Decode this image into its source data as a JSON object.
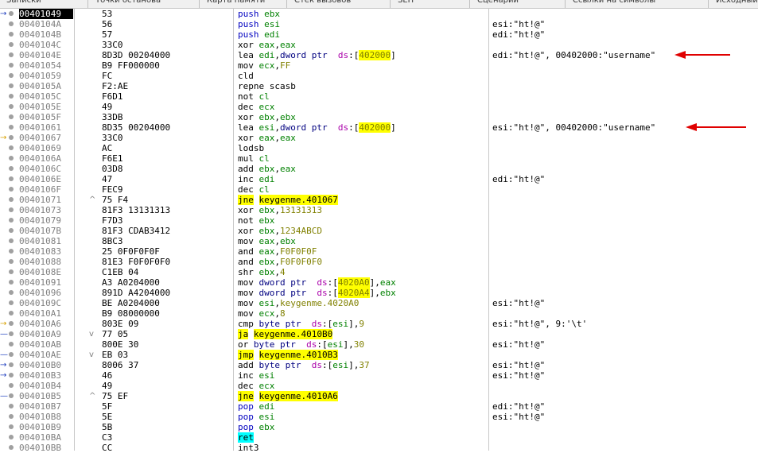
{
  "toolbar": {
    "tabs": [
      "Записки",
      "Точки останова",
      "Карта памяти",
      "Стек вызовов",
      "SEH",
      "Сценарий",
      "Ссылки на символы",
      "Исходный текст"
    ]
  },
  "rows": [
    {
      "addr": "00401049",
      "bytes": "53",
      "parts": [
        [
          "push",
          "m-b"
        ],
        [
          " ",
          ""
        ],
        [
          "ebx",
          "reg"
        ]
      ],
      "cmt": "",
      "cur": true,
      "arrow": "→"
    },
    {
      "addr": "0040104A",
      "bytes": "56",
      "parts": [
        [
          "push",
          "m-b"
        ],
        [
          " ",
          ""
        ],
        [
          "esi",
          "reg"
        ]
      ],
      "cmt": "esi:\"ht!@\""
    },
    {
      "addr": "0040104B",
      "bytes": "57",
      "parts": [
        [
          "push",
          "m-b"
        ],
        [
          " ",
          ""
        ],
        [
          "edi",
          "reg"
        ]
      ],
      "cmt": "edi:\"ht!@\""
    },
    {
      "addr": "0040104C",
      "bytes": "33C0",
      "parts": [
        [
          "xor",
          "m-n"
        ],
        [
          " ",
          ""
        ],
        [
          "eax",
          "reg"
        ],
        [
          ",",
          ""
        ],
        [
          "eax",
          "reg"
        ]
      ],
      "cmt": ""
    },
    {
      "addr": "0040104E",
      "bytes": "8D3D 00204000",
      "parts": [
        [
          "lea",
          "m-n"
        ],
        [
          " ",
          ""
        ],
        [
          "edi",
          "reg"
        ],
        [
          ",",
          ""
        ],
        [
          "dword ptr",
          "ptr"
        ],
        [
          "  ",
          ""
        ],
        [
          "ds",
          "ds"
        ],
        [
          ":[",
          ""
        ],
        [
          "402000",
          "num hl"
        ],
        [
          "]",
          ""
        ]
      ],
      "cmt": "edi:\"ht!@\", 00402000:\"username\""
    },
    {
      "addr": "00401054",
      "bytes": "B9 FF000000",
      "parts": [
        [
          "mov",
          "m-n"
        ],
        [
          " ",
          ""
        ],
        [
          "ecx",
          "reg"
        ],
        [
          ",",
          ""
        ],
        [
          "FF",
          "num"
        ]
      ],
      "cmt": ""
    },
    {
      "addr": "00401059",
      "bytes": "FC",
      "parts": [
        [
          "cld",
          "m-n"
        ]
      ],
      "cmt": ""
    },
    {
      "addr": "0040105A",
      "bytes": "F2:AE",
      "parts": [
        [
          "repne scasb",
          "m-n"
        ]
      ],
      "cmt": ""
    },
    {
      "addr": "0040105C",
      "bytes": "F6D1",
      "parts": [
        [
          "not",
          "m-n"
        ],
        [
          " ",
          ""
        ],
        [
          "cl",
          "reg"
        ]
      ],
      "cmt": ""
    },
    {
      "addr": "0040105E",
      "bytes": "49",
      "parts": [
        [
          "dec",
          "m-n"
        ],
        [
          " ",
          ""
        ],
        [
          "ecx",
          "reg"
        ]
      ],
      "cmt": ""
    },
    {
      "addr": "0040105F",
      "bytes": "33DB",
      "parts": [
        [
          "xor",
          "m-n"
        ],
        [
          " ",
          ""
        ],
        [
          "ebx",
          "reg"
        ],
        [
          ",",
          ""
        ],
        [
          "ebx",
          "reg"
        ]
      ],
      "cmt": ""
    },
    {
      "addr": "00401061",
      "bytes": "8D35 00204000",
      "parts": [
        [
          "lea",
          "m-n"
        ],
        [
          " ",
          ""
        ],
        [
          "esi",
          "reg"
        ],
        [
          ",",
          ""
        ],
        [
          "dword ptr",
          "ptr"
        ],
        [
          "  ",
          ""
        ],
        [
          "ds",
          "ds"
        ],
        [
          ":[",
          ""
        ],
        [
          "402000",
          "num hl"
        ],
        [
          "]",
          ""
        ]
      ],
      "cmt": "esi:\"ht!@\", 00402000:\"username\""
    },
    {
      "addr": "00401067",
      "bytes": "33C0",
      "parts": [
        [
          "xor",
          "m-n"
        ],
        [
          " ",
          ""
        ],
        [
          "eax",
          "reg"
        ],
        [
          ",",
          ""
        ],
        [
          "eax",
          "reg"
        ]
      ],
      "cmt": "",
      "arrow": "→",
      "arrowc": "yl"
    },
    {
      "addr": "00401069",
      "bytes": "AC",
      "parts": [
        [
          "lodsb",
          "m-n"
        ]
      ],
      "cmt": ""
    },
    {
      "addr": "0040106A",
      "bytes": "F6E1",
      "parts": [
        [
          "mul",
          "m-n"
        ],
        [
          " ",
          ""
        ],
        [
          "cl",
          "reg"
        ]
      ],
      "cmt": ""
    },
    {
      "addr": "0040106C",
      "bytes": "03D8",
      "parts": [
        [
          "add",
          "m-n"
        ],
        [
          " ",
          ""
        ],
        [
          "ebx",
          "reg"
        ],
        [
          ",",
          ""
        ],
        [
          "eax",
          "reg"
        ]
      ],
      "cmt": ""
    },
    {
      "addr": "0040106E",
      "bytes": "47",
      "parts": [
        [
          "inc",
          "m-n"
        ],
        [
          " ",
          ""
        ],
        [
          "edi",
          "reg"
        ]
      ],
      "cmt": "edi:\"ht!@\""
    },
    {
      "addr": "0040106F",
      "bytes": "FEC9",
      "parts": [
        [
          "dec",
          "m-n"
        ],
        [
          " ",
          ""
        ],
        [
          "cl",
          "reg"
        ]
      ],
      "cmt": ""
    },
    {
      "addr": "00401071",
      "bytes": "75 F4",
      "jm": "^",
      "parts": [
        [
          "jne",
          "m-n hl"
        ],
        [
          " ",
          ""
        ],
        [
          "keygenme.401067",
          "hl"
        ]
      ],
      "cmt": ""
    },
    {
      "addr": "00401073",
      "bytes": "81F3 13131313",
      "parts": [
        [
          "xor",
          "m-n"
        ],
        [
          " ",
          ""
        ],
        [
          "ebx",
          "reg"
        ],
        [
          ",",
          ""
        ],
        [
          "13131313",
          "num"
        ]
      ],
      "cmt": ""
    },
    {
      "addr": "00401079",
      "bytes": "F7D3",
      "parts": [
        [
          "not",
          "m-n"
        ],
        [
          " ",
          ""
        ],
        [
          "ebx",
          "reg"
        ]
      ],
      "cmt": ""
    },
    {
      "addr": "0040107B",
      "bytes": "81F3 CDAB3412",
      "parts": [
        [
          "xor",
          "m-n"
        ],
        [
          " ",
          ""
        ],
        [
          "ebx",
          "reg"
        ],
        [
          ",",
          ""
        ],
        [
          "1234ABCD",
          "num"
        ]
      ],
      "cmt": ""
    },
    {
      "addr": "00401081",
      "bytes": "8BC3",
      "parts": [
        [
          "mov",
          "m-n"
        ],
        [
          " ",
          ""
        ],
        [
          "eax",
          "reg"
        ],
        [
          ",",
          ""
        ],
        [
          "ebx",
          "reg"
        ]
      ],
      "cmt": ""
    },
    {
      "addr": "00401083",
      "bytes": "25 0F0F0F0F",
      "parts": [
        [
          "and",
          "m-n"
        ],
        [
          " ",
          ""
        ],
        [
          "eax",
          "reg"
        ],
        [
          ",",
          ""
        ],
        [
          "F0F0F0F",
          "num"
        ]
      ],
      "cmt": ""
    },
    {
      "addr": "00401088",
      "bytes": "81E3 F0F0F0F0",
      "parts": [
        [
          "and",
          "m-n"
        ],
        [
          " ",
          ""
        ],
        [
          "ebx",
          "reg"
        ],
        [
          ",",
          ""
        ],
        [
          "F0F0F0F0",
          "num"
        ]
      ],
      "cmt": ""
    },
    {
      "addr": "0040108E",
      "bytes": "C1EB 04",
      "parts": [
        [
          "shr",
          "m-n"
        ],
        [
          " ",
          ""
        ],
        [
          "ebx",
          "reg"
        ],
        [
          ",",
          ""
        ],
        [
          "4",
          "num"
        ]
      ],
      "cmt": ""
    },
    {
      "addr": "00401091",
      "bytes": "A3 A0204000",
      "parts": [
        [
          "mov",
          "m-n"
        ],
        [
          " ",
          ""
        ],
        [
          "dword ptr",
          "ptr"
        ],
        [
          "  ",
          ""
        ],
        [
          "ds",
          "ds"
        ],
        [
          ":[",
          ""
        ],
        [
          "4020A0",
          "num hl"
        ],
        [
          "]",
          ""
        ],
        [
          ",",
          ""
        ],
        [
          "eax",
          "reg"
        ]
      ],
      "cmt": ""
    },
    {
      "addr": "00401096",
      "bytes": "891D A4204000",
      "parts": [
        [
          "mov",
          "m-n"
        ],
        [
          " ",
          ""
        ],
        [
          "dword ptr",
          "ptr"
        ],
        [
          "  ",
          ""
        ],
        [
          "ds",
          "ds"
        ],
        [
          ":[",
          ""
        ],
        [
          "4020A4",
          "num hl"
        ],
        [
          "]",
          ""
        ],
        [
          ",",
          ""
        ],
        [
          "ebx",
          "reg"
        ]
      ],
      "cmt": ""
    },
    {
      "addr": "0040109C",
      "bytes": "BE A0204000",
      "parts": [
        [
          "mov",
          "m-n"
        ],
        [
          " ",
          ""
        ],
        [
          "esi",
          "reg"
        ],
        [
          ",",
          ""
        ],
        [
          "keygenme.4020A0",
          "num"
        ]
      ],
      "cmt": "esi:\"ht!@\""
    },
    {
      "addr": "004010A1",
      "bytes": "B9 08000000",
      "parts": [
        [
          "mov",
          "m-n"
        ],
        [
          " ",
          ""
        ],
        [
          "ecx",
          "reg"
        ],
        [
          ",",
          ""
        ],
        [
          "8",
          "num"
        ]
      ],
      "cmt": ""
    },
    {
      "addr": "004010A6",
      "bytes": "803E 09",
      "parts": [
        [
          "cmp",
          "m-n"
        ],
        [
          " ",
          ""
        ],
        [
          "byte ptr",
          "ptr"
        ],
        [
          "  ",
          ""
        ],
        [
          "ds",
          "ds"
        ],
        [
          ":[",
          ""
        ],
        [
          "esi",
          "reg"
        ],
        [
          "]",
          ""
        ],
        [
          ",",
          ""
        ],
        [
          "9",
          "num"
        ]
      ],
      "cmt": "esi:\"ht!@\", 9:'\\t'",
      "arrow": "→",
      "arrowc": "yl"
    },
    {
      "addr": "004010A9",
      "bytes": "77 05",
      "jm": "v",
      "parts": [
        [
          "ja",
          "m-n hl"
        ],
        [
          " ",
          ""
        ],
        [
          "keygenme.4010B0",
          "hl"
        ]
      ],
      "cmt": "",
      "arrow": "—"
    },
    {
      "addr": "004010AB",
      "bytes": "800E 30",
      "parts": [
        [
          "or",
          "m-n"
        ],
        [
          " ",
          ""
        ],
        [
          "byte ptr",
          "ptr"
        ],
        [
          "  ",
          ""
        ],
        [
          "ds",
          "ds"
        ],
        [
          ":[",
          ""
        ],
        [
          "esi",
          "reg"
        ],
        [
          "]",
          ""
        ],
        [
          ",",
          ""
        ],
        [
          "30",
          "num"
        ]
      ],
      "cmt": "esi:\"ht!@\""
    },
    {
      "addr": "004010AE",
      "bytes": "EB 03",
      "jm": "v",
      "parts": [
        [
          "jmp",
          "m-n hl"
        ],
        [
          " ",
          ""
        ],
        [
          "keygenme.4010B3",
          "hl"
        ]
      ],
      "cmt": "",
      "arrow": "—"
    },
    {
      "addr": "004010B0",
      "bytes": "8006 37",
      "parts": [
        [
          "add",
          "m-n"
        ],
        [
          " ",
          ""
        ],
        [
          "byte ptr",
          "ptr"
        ],
        [
          "  ",
          ""
        ],
        [
          "ds",
          "ds"
        ],
        [
          ":[",
          ""
        ],
        [
          "esi",
          "reg"
        ],
        [
          "]",
          ""
        ],
        [
          ",",
          ""
        ],
        [
          "37",
          "num"
        ]
      ],
      "cmt": "esi:\"ht!@\"",
      "arrow": "→"
    },
    {
      "addr": "004010B3",
      "bytes": "46",
      "parts": [
        [
          "inc",
          "m-n"
        ],
        [
          " ",
          ""
        ],
        [
          "esi",
          "reg"
        ]
      ],
      "cmt": "esi:\"ht!@\"",
      "arrow": "→"
    },
    {
      "addr": "004010B4",
      "bytes": "49",
      "parts": [
        [
          "dec",
          "m-n"
        ],
        [
          " ",
          ""
        ],
        [
          "ecx",
          "reg"
        ]
      ],
      "cmt": ""
    },
    {
      "addr": "004010B5",
      "bytes": "75 EF",
      "jm": "^",
      "parts": [
        [
          "jne",
          "m-n hl"
        ],
        [
          " ",
          ""
        ],
        [
          "keygenme.4010A6",
          "hl"
        ]
      ],
      "cmt": "",
      "arrow": "—"
    },
    {
      "addr": "004010B7",
      "bytes": "5F",
      "parts": [
        [
          "pop",
          "m-b"
        ],
        [
          " ",
          ""
        ],
        [
          "edi",
          "reg"
        ]
      ],
      "cmt": "edi:\"ht!@\""
    },
    {
      "addr": "004010B8",
      "bytes": "5E",
      "parts": [
        [
          "pop",
          "m-b"
        ],
        [
          " ",
          ""
        ],
        [
          "esi",
          "reg"
        ]
      ],
      "cmt": "esi:\"ht!@\""
    },
    {
      "addr": "004010B9",
      "bytes": "5B",
      "parts": [
        [
          "pop",
          "m-b"
        ],
        [
          " ",
          ""
        ],
        [
          "ebx",
          "reg"
        ]
      ],
      "cmt": ""
    },
    {
      "addr": "004010BA",
      "bytes": "C3",
      "parts": [
        [
          "ret",
          "m-n hlc"
        ]
      ],
      "cmt": ""
    },
    {
      "addr": "004010BB",
      "bytes": "CC",
      "parts": [
        [
          "int3",
          "m-n"
        ]
      ],
      "cmt": ""
    }
  ],
  "annotations": {
    "arrow_color": "#e00000",
    "arrow_rows": [
      4,
      11
    ]
  }
}
